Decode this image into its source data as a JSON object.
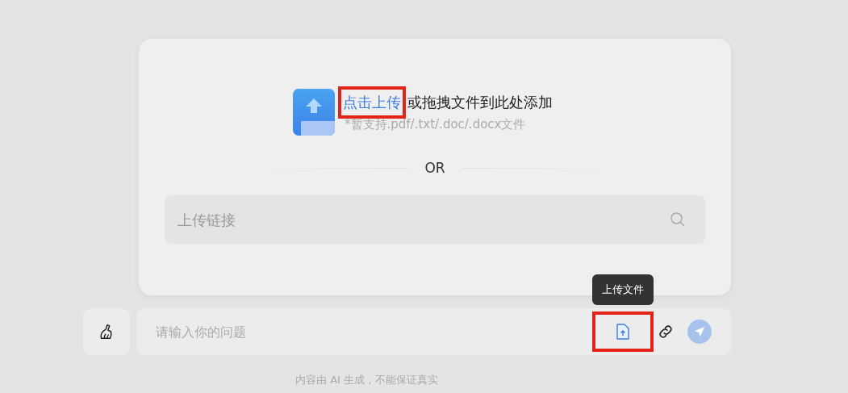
{
  "upload_panel": {
    "upload_link": {
      "label": "点击上传",
      "highlighted": true
    },
    "drop_text": "或拖拽文件到此处添加",
    "hint": "*暂支持.pdf/.txt/.doc/.docx文件",
    "divider_label": "OR",
    "link_field": {
      "placeholder": "上传链接"
    }
  },
  "composer": {
    "placeholder": "请输入你的问题",
    "upload_button": {
      "highlighted": true,
      "tooltip": "上传文件"
    }
  },
  "footer": "内容由 AI 生成，不能保证真实"
}
